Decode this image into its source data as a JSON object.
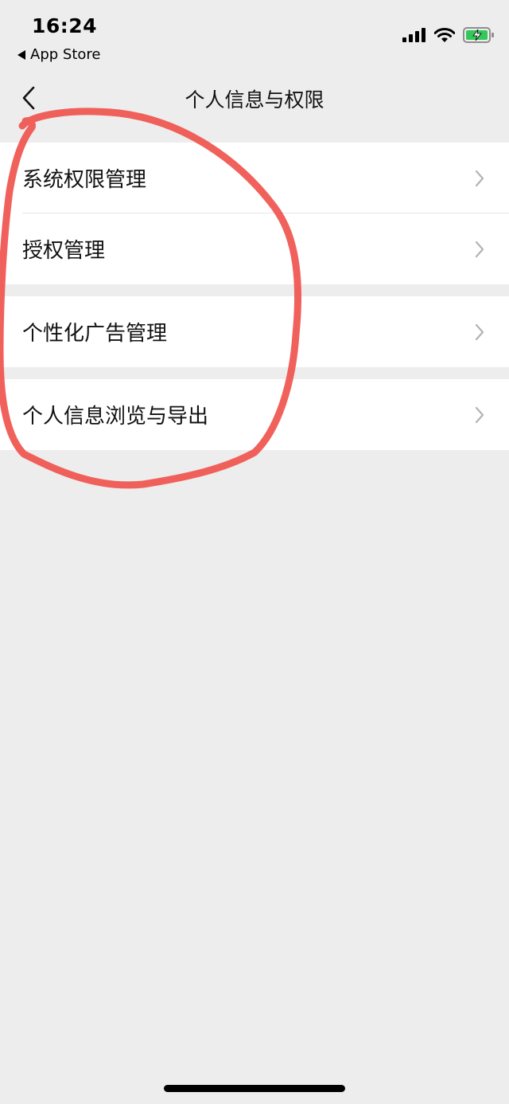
{
  "status_bar": {
    "time": "16:24",
    "back_app_label": "App Store",
    "icons": [
      "signal-icon",
      "wifi-icon",
      "battery-charging-icon"
    ]
  },
  "nav": {
    "title": "个人信息与权限",
    "back_icon": "chevron-left-icon"
  },
  "groups": [
    {
      "items": [
        {
          "label": "系统权限管理"
        },
        {
          "label": "授权管理"
        }
      ]
    },
    {
      "items": [
        {
          "label": "个性化广告管理"
        }
      ]
    },
    {
      "items": [
        {
          "label": "个人信息浏览与导出"
        }
      ]
    }
  ],
  "colors": {
    "background": "#ededed",
    "card": "#ffffff",
    "annotation_stroke": "#f0504a",
    "battery_fill": "#34c759"
  }
}
